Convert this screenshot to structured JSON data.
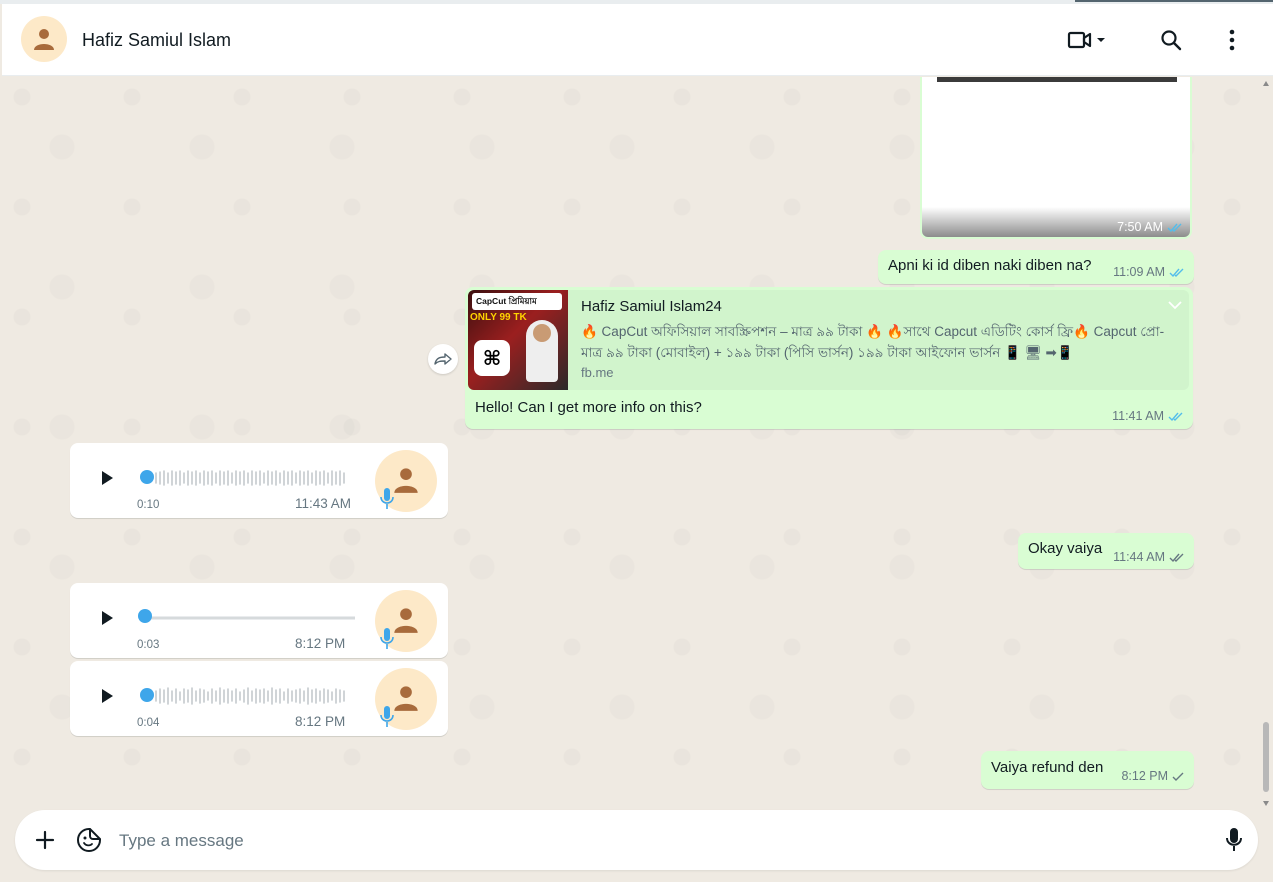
{
  "header": {
    "contact_name": "Hafiz Samiul Islam",
    "icons": [
      "avatar-icon",
      "video-call-icon",
      "chevron-down-icon",
      "search-icon",
      "menu-dots-icon"
    ]
  },
  "colors": {
    "outgoing_bubble": "#d9fdd3",
    "incoming_bubble": "#ffffff",
    "read_tick": "#53bdeb",
    "chat_background": "#efeae2",
    "voice_accent": "#3ea6ea"
  },
  "messages": {
    "image": {
      "time": "7:50 AM",
      "status": "read"
    },
    "msg1": {
      "text": "Apni ki id diben naki diben na?",
      "time": "11:09 AM",
      "status": "read"
    },
    "link": {
      "thumb_badge": "CapCut প্রিমিয়াম",
      "thumb_price": "ONLY 99 TK",
      "title": "Hafiz Samiul Islam24",
      "description": "🔥 CapCut অফিসিয়াল সাবস্ক্রিপশন – মাত্র ৯৯ টাকা 🔥 🔥সাথে Capcut এডিটিং কোর্স ফ্রি🔥 Capcut প্রো-মাত্র ৯৯ টাকা (মোবাইল) + ১৯৯ টাকা (পিসি ভার্সন) ১৯৯ টাকা আইফোন ভার্সন 📱 🖥 ➡📱",
      "url": "fb.me",
      "text": "Hello! Can I get more info on this?",
      "time": "11:41 AM",
      "status": "read"
    },
    "voice1": {
      "duration": "0:10",
      "time": "11:43 AM",
      "progress": 0
    },
    "msg2": {
      "text": "Okay vaiya",
      "time": "11:44 AM",
      "status": "delivered"
    },
    "voice2": {
      "duration": "0:03",
      "time": "8:12 PM",
      "progress": 0
    },
    "voice3": {
      "duration": "0:04",
      "time": "8:12 PM",
      "progress": 0
    },
    "msg3": {
      "text": "Vaiya refund den",
      "time": "8:12 PM",
      "status": "sent"
    }
  },
  "composer": {
    "placeholder": "Type a message",
    "icons": [
      "plus-icon",
      "sticker-icon",
      "mic-icon"
    ]
  }
}
